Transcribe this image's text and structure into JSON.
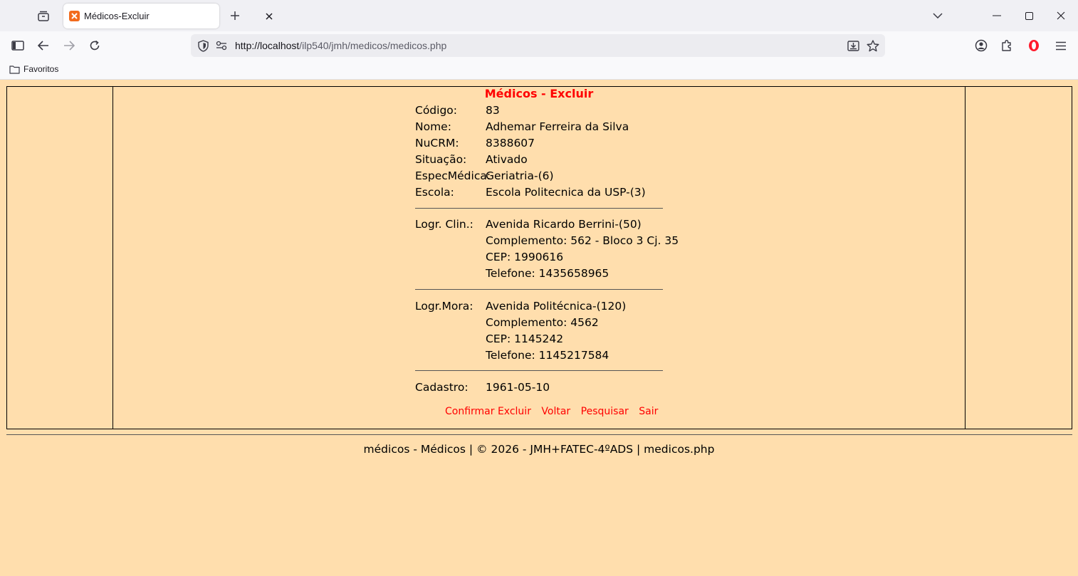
{
  "browser": {
    "tab_title": "Médicos-Excluir",
    "url_host": "http://localhost",
    "url_path": "/ilp540/jmh/medicos/medicos.php",
    "bookmark_folder": "Favoritos"
  },
  "page": {
    "title": "Médicos - Excluir",
    "fields": [
      {
        "label": "Código:",
        "value": "83"
      },
      {
        "label": "Nome:",
        "value": "Adhemar Ferreira da Silva"
      },
      {
        "label": "NuCRM:",
        "value": "8388607"
      },
      {
        "label": "Situação:",
        "value": "Ativado"
      },
      {
        "label": "EspecMédica:",
        "value": "Geriatria-(6)"
      },
      {
        "label": "Escola:",
        "value": "Escola Politecnica da USP-(3)"
      }
    ],
    "clinic": {
      "label": "Logr. Clin.:",
      "street": "Avenida Ricardo Berrini-(50)",
      "complement": "Complemento: 562 - Bloco 3 Cj. 35",
      "cep": "CEP: 1990616",
      "phone": "Telefone: 1435658965"
    },
    "home": {
      "label": "Logr.Mora:",
      "street": "Avenida Politécnica-(120)",
      "complement": "Complemento: 4562",
      "cep": "CEP: 1145242",
      "phone": "Telefone: 1145217584"
    },
    "registration": {
      "label": "Cadastro:",
      "value": "1961-05-10"
    },
    "actions": {
      "confirm": "Confirmar Excluir",
      "back": "Voltar",
      "search": "Pesquisar",
      "exit": "Sair"
    },
    "footer": "médicos - Médicos | © 2026 - JMH+FATEC-4ºADS | medicos.php"
  },
  "colors": {
    "page_background": "#ffdead",
    "accent_red": "#ff0000"
  }
}
